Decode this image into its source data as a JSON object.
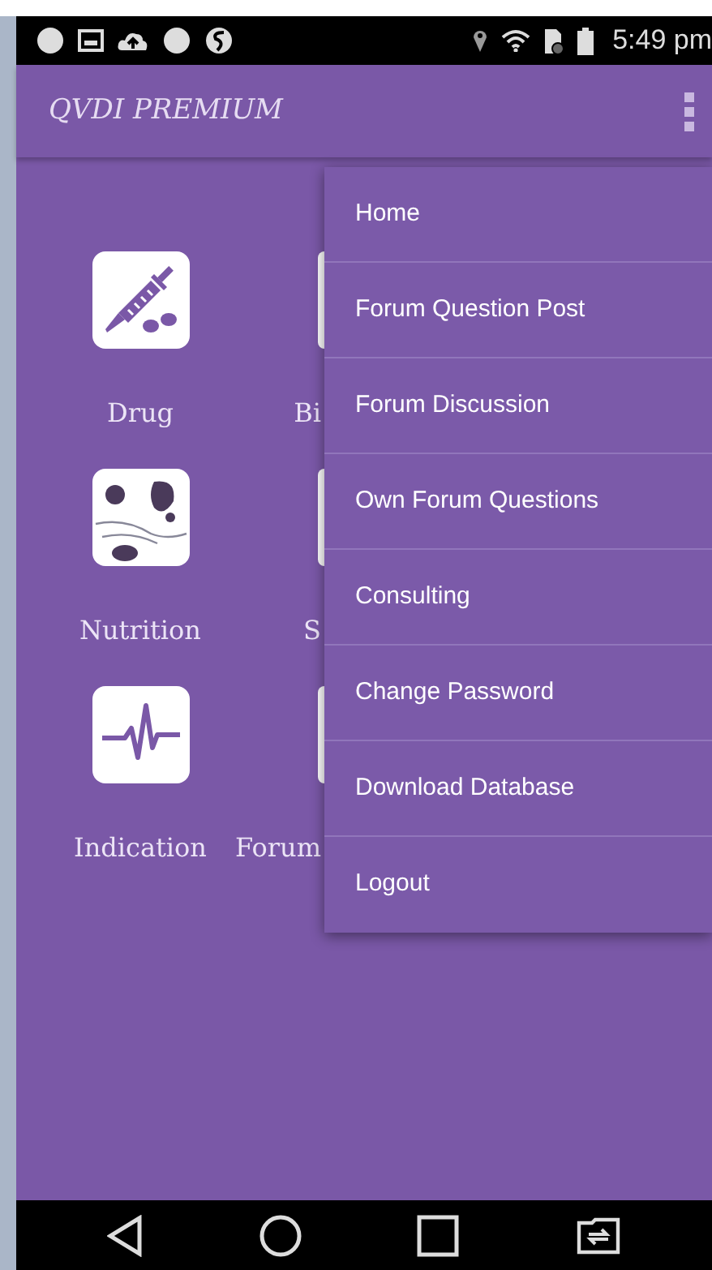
{
  "status_bar": {
    "time": "5:49 pm"
  },
  "app_bar": {
    "title": "QVDI PREMIUM"
  },
  "grid": [
    {
      "label": "Drug",
      "kind": "syringe"
    },
    {
      "label": "Bi",
      "kind": "partial"
    },
    {
      "label": "Nutrition",
      "kind": "cow"
    },
    {
      "label": "S",
      "kind": "partial"
    },
    {
      "label": "Indication",
      "kind": "pulse"
    },
    {
      "label": "Forum",
      "kind": "partial"
    }
  ],
  "menu": {
    "items": [
      {
        "label": "Home"
      },
      {
        "label": "Forum Question Post"
      },
      {
        "label": "Forum Discussion"
      },
      {
        "label": "Own Forum Questions"
      },
      {
        "label": "Consulting"
      },
      {
        "label": "Change Password"
      },
      {
        "label": "Download Database"
      },
      {
        "label": "Logout"
      }
    ]
  }
}
